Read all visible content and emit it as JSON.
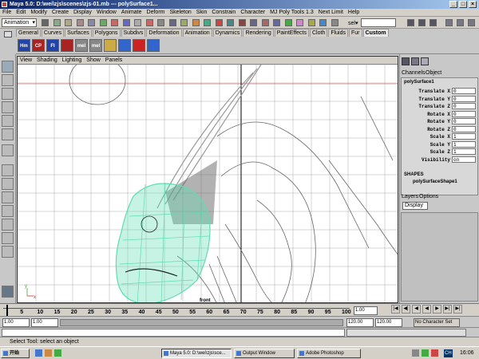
{
  "window": {
    "title": "Maya 5.0: D:\\wei\\zjs\\scenes\\zjs-01.mb  ---  polySurface1..."
  },
  "menu": [
    "File",
    "Edit",
    "Modify",
    "Create",
    "Display",
    "Window",
    "Animate",
    "Deform",
    "Skeleton",
    "Skin",
    "Constrain",
    "Character",
    "MJ Poly Tools 1.3",
    "Next Limit",
    "Help"
  ],
  "status_line": {
    "mode": "Animation",
    "sel_label": "sel▾"
  },
  "shelf_tabs": [
    "General",
    "Curves",
    "Surfaces",
    "Polygons",
    "Subdivs",
    "Deformation",
    "Animation",
    "Dynamics",
    "Rendering",
    "PaintEffects",
    "Cloth",
    "Fluids",
    "Fur",
    "Custom"
  ],
  "shelf_icons": [
    {
      "label": "Hm",
      "color": "#2244aa"
    },
    {
      "label": "CP",
      "color": "#aa2222"
    },
    {
      "label": "FI",
      "color": "#2244aa"
    },
    {
      "label": "",
      "color": "#aa2222"
    },
    {
      "label": "mel",
      "color": "#888888"
    },
    {
      "label": "mel",
      "color": "#888888"
    },
    {
      "label": "",
      "color": "#ccaa44"
    },
    {
      "label": "",
      "color": "#3366cc"
    },
    {
      "label": "",
      "color": "#cc2222"
    },
    {
      "label": "",
      "color": "#3366cc"
    }
  ],
  "viewport": {
    "menu": [
      "View",
      "Shading",
      "Lighting",
      "Show",
      "Panels"
    ],
    "camera": "front",
    "axis_y": "y",
    "axis_x": "x"
  },
  "channel_box": {
    "tabs": [
      "Channels",
      "Object"
    ],
    "node": "polySurface1",
    "attrs": [
      {
        "name": "Translate X",
        "value": "0"
      },
      {
        "name": "Translate Y",
        "value": "0"
      },
      {
        "name": "Translate Z",
        "value": "0"
      },
      {
        "name": "Rotate X",
        "value": "0"
      },
      {
        "name": "Rotate Y",
        "value": "0"
      },
      {
        "name": "Rotate Z",
        "value": "0"
      },
      {
        "name": "Scale X",
        "value": "1"
      },
      {
        "name": "Scale Y",
        "value": "1"
      },
      {
        "name": "Scale Z",
        "value": "1"
      },
      {
        "name": "Visibility",
        "value": "on"
      }
    ],
    "shapes_label": "SHAPES",
    "shape_node": "polySurfaceShape1"
  },
  "layers": {
    "tabs": [
      "Layers",
      "Options"
    ],
    "display": "Display"
  },
  "timeline": {
    "ticks": [
      "5",
      "10",
      "15",
      "20",
      "25",
      "30",
      "35",
      "40",
      "45",
      "50",
      "55",
      "60",
      "65",
      "70",
      "75",
      "80",
      "85",
      "90",
      "95",
      "100"
    ],
    "current": "1.00"
  },
  "range": {
    "start": "1.00",
    "start2": "1.00",
    "end": "120.00",
    "end2": "120.00",
    "char_set": "No Character Set"
  },
  "help_line": "Select Tool: select an object",
  "taskbar": {
    "start": "开始",
    "items": [
      "Maya 5.0: D:\\wei\\zjs\\sce...",
      "Output Window",
      "Adobe Photoshop"
    ],
    "lang": "CH",
    "clock": "16:06"
  },
  "colors": {
    "title_start": "#0a246a",
    "title_end": "#a6caf0",
    "selected_mesh": "#5fdcb4",
    "viewport_bg": "#ffffff"
  }
}
